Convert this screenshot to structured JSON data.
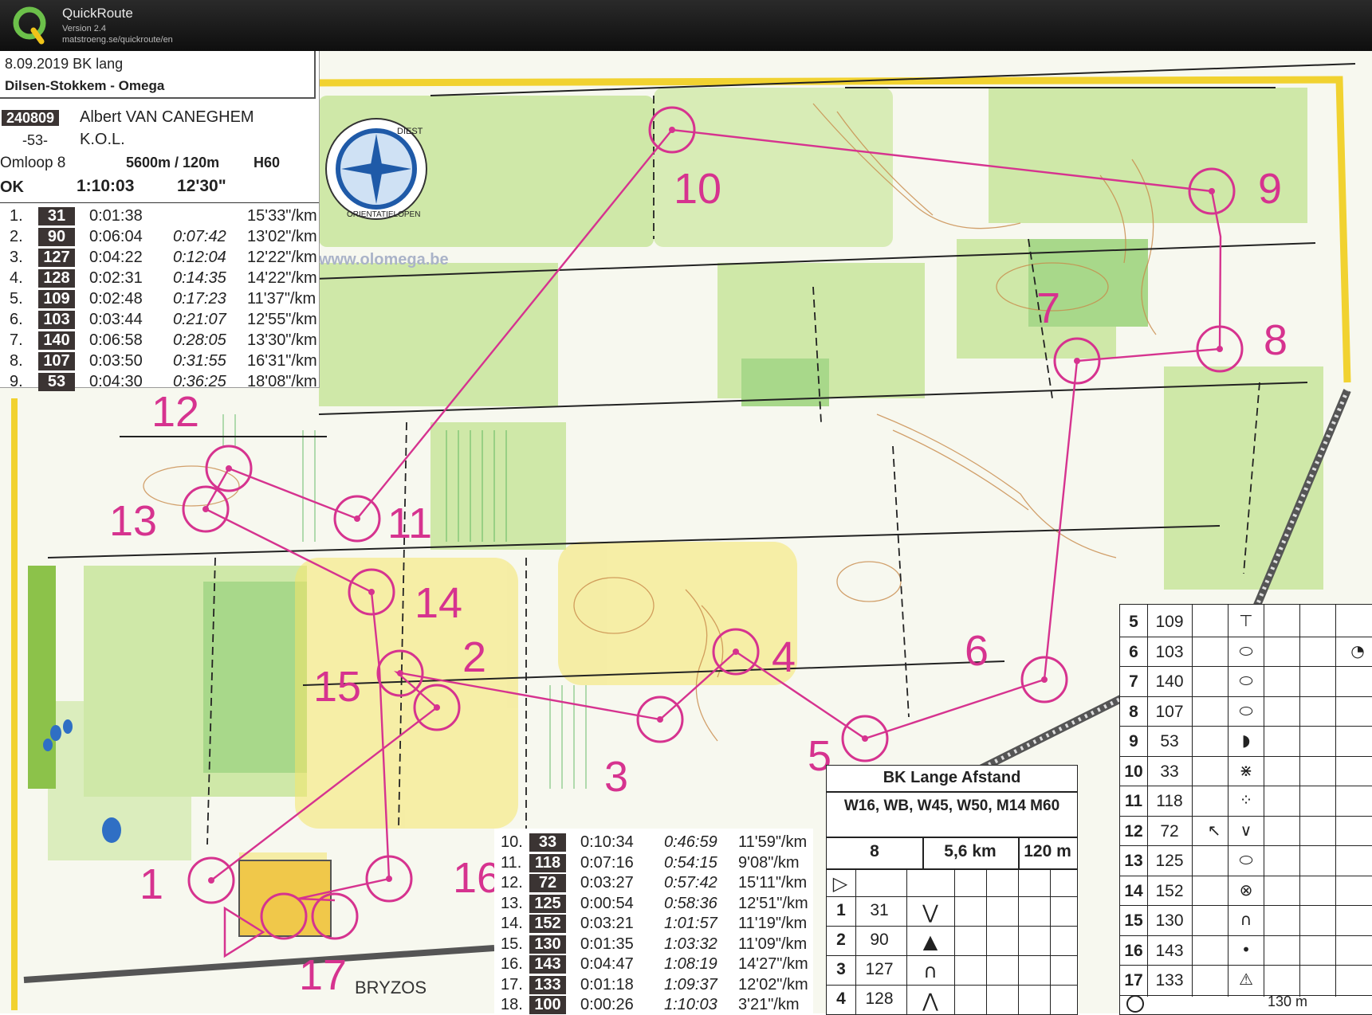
{
  "app": {
    "name": "QuickRoute",
    "version": "Version 2.4",
    "url": "matstroeng.se/quickroute/en"
  },
  "header": {
    "date_event": "8.09.2019  BK lang",
    "location": "Dilsen-Stokkem - Omega",
    "id": "240809",
    "runner": "Albert VAN CANEGHEM",
    "age": "-53-",
    "club": "K.O.L.",
    "course_label": "Omloop  8",
    "distance": "5600m / 120m",
    "category": "H60",
    "status": "OK",
    "total_time": "1:10:03",
    "pace": "12'30\""
  },
  "logo": {
    "text_top": "DIEST",
    "text_bottom": "ORIENTATIELOPEN"
  },
  "website": "www.olomega.be",
  "splits": [
    {
      "n": "1.",
      "code": "31",
      "split": "0:01:38",
      "cum": "",
      "pace": "15'33\"/km"
    },
    {
      "n": "2.",
      "code": "90",
      "split": "0:06:04",
      "cum": "0:07:42",
      "pace": "13'02\"/km"
    },
    {
      "n": "3.",
      "code": "127",
      "split": "0:04:22",
      "cum": "0:12:04",
      "pace": "12'22\"/km"
    },
    {
      "n": "4.",
      "code": "128",
      "split": "0:02:31",
      "cum": "0:14:35",
      "pace": "14'22\"/km"
    },
    {
      "n": "5.",
      "code": "109",
      "split": "0:02:48",
      "cum": "0:17:23",
      "pace": "11'37\"/km"
    },
    {
      "n": "6.",
      "code": "103",
      "split": "0:03:44",
      "cum": "0:21:07",
      "pace": "12'55\"/km"
    },
    {
      "n": "7.",
      "code": "140",
      "split": "0:06:58",
      "cum": "0:28:05",
      "pace": "13'30\"/km"
    },
    {
      "n": "8.",
      "code": "107",
      "split": "0:03:50",
      "cum": "0:31:55",
      "pace": "16'31\"/km"
    },
    {
      "n": "9.",
      "code": "53",
      "split": "0:04:30",
      "cum": "0:36:25",
      "pace": "18'08\"/km"
    },
    {
      "n": "10.",
      "code": "33",
      "split": "0:10:34",
      "cum": "0:46:59",
      "pace": "11'59\"/km"
    },
    {
      "n": "11.",
      "code": "118",
      "split": "0:07:16",
      "cum": "0:54:15",
      "pace": "9'08\"/km"
    },
    {
      "n": "12.",
      "code": "72",
      "split": "0:03:27",
      "cum": "0:57:42",
      "pace": "15'11\"/km"
    },
    {
      "n": "13.",
      "code": "125",
      "split": "0:00:54",
      "cum": "0:58:36",
      "pace": "12'51\"/km"
    },
    {
      "n": "14.",
      "code": "152",
      "split": "0:03:21",
      "cum": "1:01:57",
      "pace": "11'19\"/km"
    },
    {
      "n": "15.",
      "code": "130",
      "split": "0:01:35",
      "cum": "1:03:32",
      "pace": "11'09\"/km"
    },
    {
      "n": "16.",
      "code": "143",
      "split": "0:04:47",
      "cum": "1:08:19",
      "pace": "14'27\"/km"
    },
    {
      "n": "17.",
      "code": "133",
      "split": "0:01:18",
      "cum": "1:09:37",
      "pace": "12'02\"/km"
    },
    {
      "n": "18.",
      "code": "100",
      "split": "0:00:26",
      "cum": "1:10:03",
      "pace": "3'21\"/km"
    }
  ],
  "course_card": {
    "title": "BK Lange Afstand",
    "classes": "W16, WB, W45, W50, M14 M60",
    "course": "8",
    "length": "5,6 km",
    "climb": "120 m",
    "rows": [
      {
        "n": "1",
        "code": "31",
        "sym": "⋁"
      },
      {
        "n": "2",
        "code": "90",
        "sym": "▲"
      },
      {
        "n": "3",
        "code": "127",
        "sym": "∩"
      },
      {
        "n": "4",
        "code": "128",
        "sym": "⋀"
      }
    ]
  },
  "description_rows": [
    {
      "n": "5",
      "code": "109"
    },
    {
      "n": "6",
      "code": "103"
    },
    {
      "n": "7",
      "code": "140"
    },
    {
      "n": "8",
      "code": "107"
    },
    {
      "n": "9",
      "code": "53"
    },
    {
      "n": "10",
      "code": "33"
    },
    {
      "n": "11",
      "code": "118"
    },
    {
      "n": "12",
      "code": "72"
    },
    {
      "n": "13",
      "code": "125"
    },
    {
      "n": "14",
      "code": "152"
    },
    {
      "n": "15",
      "code": "130"
    },
    {
      "n": "16",
      "code": "143"
    },
    {
      "n": "17",
      "code": "133"
    }
  ],
  "footer_distance": "130 m",
  "sponsor": "BRYZOS",
  "controls": [
    "1",
    "2",
    "3",
    "4",
    "5",
    "6",
    "7",
    "8",
    "9",
    "10",
    "11",
    "12",
    "13",
    "14",
    "15",
    "16",
    "17"
  ],
  "colors": {
    "course": "#d6338f",
    "forest_light": "#cfe8a8",
    "forest_med": "#a8d88a",
    "yellow_open": "#f5e56a",
    "contour": "#c88a4a",
    "water": "#2f6fc4"
  }
}
